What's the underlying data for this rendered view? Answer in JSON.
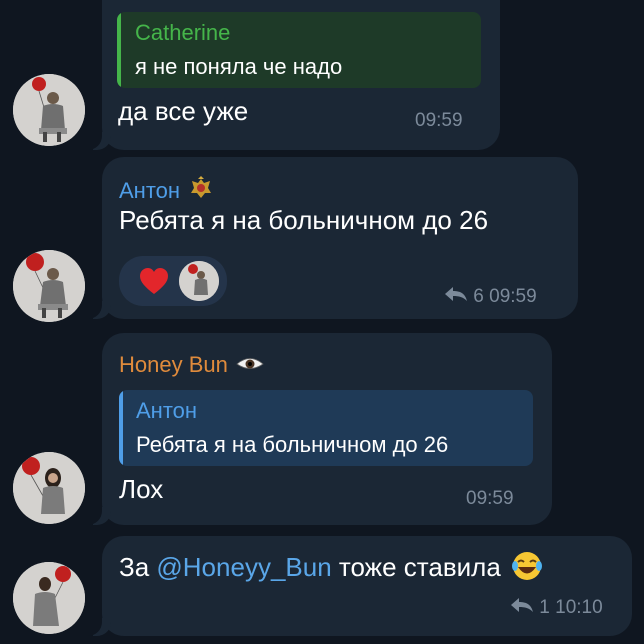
{
  "messages": [
    {
      "reply": {
        "name": "Catherine",
        "text": "я не поняла че надо"
      },
      "text": "да все уже",
      "time": "09:59"
    },
    {
      "sender": "Антон",
      "sender_badge_icon": "emblem-icon",
      "text": "Ребята я на больничном до 26",
      "reactions": [
        {
          "icon": "red-heart-icon"
        }
      ],
      "replies": "6",
      "time": "09:59"
    },
    {
      "sender": "Honey Bun",
      "sender_badge_icon": "eye-icon",
      "reply": {
        "name": "Антон",
        "text": "Ребята я на больничном до 26"
      },
      "text": "Лох",
      "time": "09:59"
    },
    {
      "text_before": "За ",
      "mention": "@Honeyy_Bun",
      "text_after": " тоже ставила",
      "emoji_icon": "laughing-face-icon",
      "replies": "1",
      "time": "10:10"
    }
  ],
  "colors": {
    "background": "#0f1620",
    "bubble": "#1b2735",
    "catherine": "#45b54a",
    "anton": "#4f9ee8",
    "honey_bun": "#e08b3c",
    "mention": "#5aa6e8",
    "time": "#7c8a9a"
  }
}
